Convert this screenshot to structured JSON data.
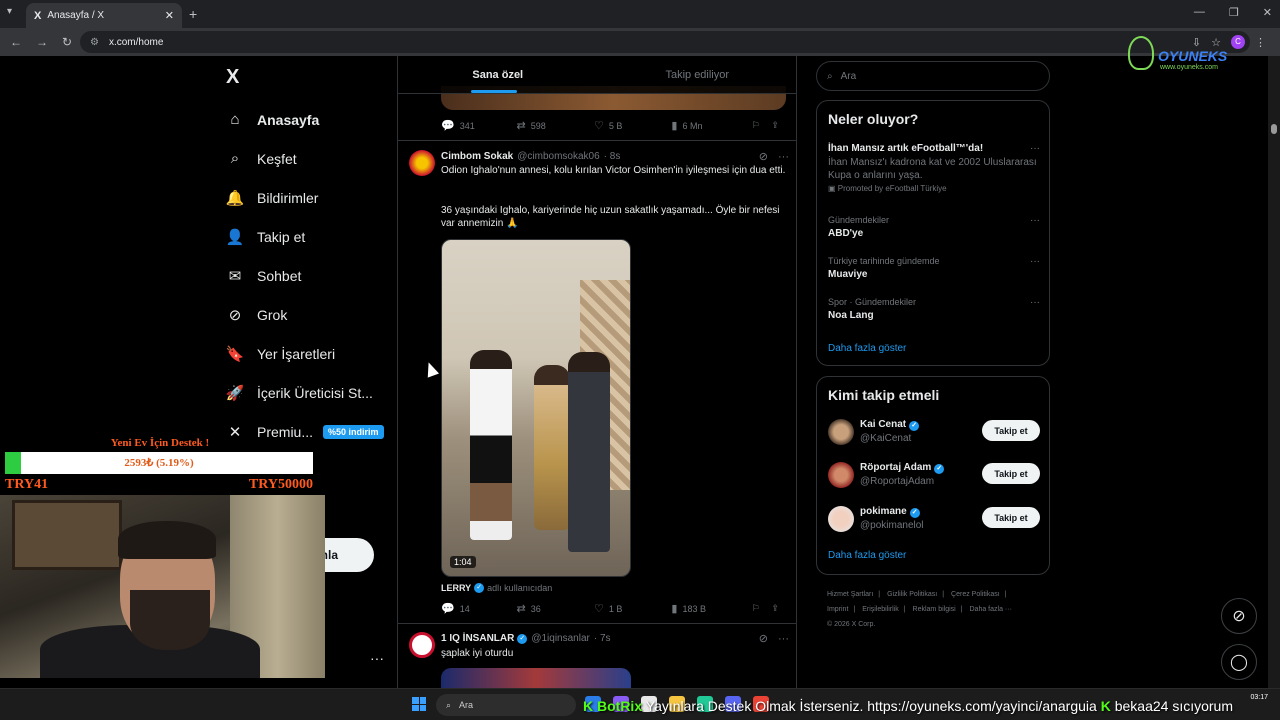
{
  "browser": {
    "tab_title": "Anasayfa / X",
    "tab_favicon": "X",
    "url": "x.com/home",
    "profile_letter": "C"
  },
  "overlay": {
    "oyuneks_brand": "OYUNEKS",
    "oyuneks_sub": "www.oyuneks.com",
    "donate_title": "Yeni Ev İçin Destek !",
    "donate_progress_text": "2593₺ (5.19%)",
    "donate_progress": 0.0519,
    "donate_min": "TRY41",
    "donate_max": "TRY50000",
    "ticker_user1": "BotRix",
    "ticker_msg1": "Yayınlara Destek Olmak İsterseniz. https://oyuneks.com/yayinci/anarguia",
    "ticker_user2": "bekaa24",
    "ticker_msg2": "sıcıyorum"
  },
  "sidebar": {
    "logo": "X",
    "items": [
      {
        "label": "Anasayfa",
        "icon": "home-icon",
        "glyph": "⌂",
        "active": true
      },
      {
        "label": "Keşfet",
        "icon": "search-icon",
        "glyph": "⌕"
      },
      {
        "label": "Bildirimler",
        "icon": "bell-icon",
        "glyph": "🔔"
      },
      {
        "label": "Takip et",
        "icon": "person-add-icon",
        "glyph": "👤"
      },
      {
        "label": "Sohbet",
        "icon": "mail-icon",
        "glyph": "✉"
      },
      {
        "label": "Grok",
        "icon": "grok-icon",
        "glyph": "⊘"
      },
      {
        "label": "Yer İşaretleri",
        "icon": "bookmark-icon",
        "glyph": "🔖"
      },
      {
        "label": "İçerik Üreticisi St...",
        "icon": "rocket-icon",
        "glyph": "🚀"
      },
      {
        "label": "Premiu...",
        "icon": "x-icon",
        "glyph": "✕",
        "badge": "%50 indirim"
      }
    ],
    "post_button_partial": "nla",
    "more": "···"
  },
  "feed": {
    "tabs": [
      "Sana özel",
      "Takip ediliyor"
    ],
    "prev_post_actions": {
      "replies": "341",
      "reposts": "598",
      "likes": "5 B",
      "views": "6 Mn"
    },
    "post1": {
      "name": "Cimbom Sokak",
      "handle": "@cimbomsokak06",
      "time": "· 8s",
      "text1": "Odion Ighalo'nun annesi, kolu kırılan Victor Osimhen'in iyileşmesi için dua etti.",
      "text2": "36 yaşındaki Ighalo, kariyerinde hiç uzun sakatlık yaşamadı... Öyle bir nefesi var annemizin 🙏",
      "video_duration": "1:04",
      "media_credit_name": "LERRY",
      "media_credit_suffix": "adlı kullanıcıdan",
      "actions": {
        "replies": "14",
        "reposts": "36",
        "likes": "1 B",
        "views": "183 B"
      }
    },
    "post2": {
      "name": "1 IQ İNSANLAR",
      "handle": "@1iqinsanlar",
      "time": "· 7s",
      "text": "şaplak iyi oturdu"
    }
  },
  "right": {
    "search_placeholder": "Ara",
    "trends_title": "Neler oluyor?",
    "trends": [
      {
        "name": "İhan Mansız artık eFootball™'da!",
        "desc": "İhan Mansız'ı kadrona kat ve 2002 Uluslararası Kupa o anlarını yaşa.",
        "promo": "Promoted by eFootball Türkiye"
      },
      {
        "category": "Gündemdekiler",
        "name": "ABD'ye"
      },
      {
        "category": "Türkiye tarihinde gündemde",
        "name": "Muaviye"
      },
      {
        "category": "Spor · Gündemdekiler",
        "name": "Noa Lang"
      }
    ],
    "trends_more": "Daha fazla göster",
    "who_title": "Kimi takip etmeli",
    "who": [
      {
        "name": "Kai Cenat",
        "handle": "@KaiCenat",
        "button": "Takip et"
      },
      {
        "name": "Röportaj Adam",
        "handle": "@RoportajAdam",
        "button": "Takip et"
      },
      {
        "name": "pokimane",
        "handle": "@pokimanelol",
        "button": "Takip et"
      }
    ],
    "who_more": "Daha fazla göster",
    "footer": [
      "Hizmet Şartları",
      "|",
      "Gizlilik Politikası",
      "|",
      "Çerez Politikası",
      "|",
      "Imprint",
      "|",
      "Erişilebilirlik",
      "|",
      "Reklam bilgisi",
      "|",
      "Daha fazla ···",
      "© 2026 X Corp."
    ]
  },
  "taskbar": {
    "search_placeholder": "Ara",
    "time": "03:17"
  }
}
